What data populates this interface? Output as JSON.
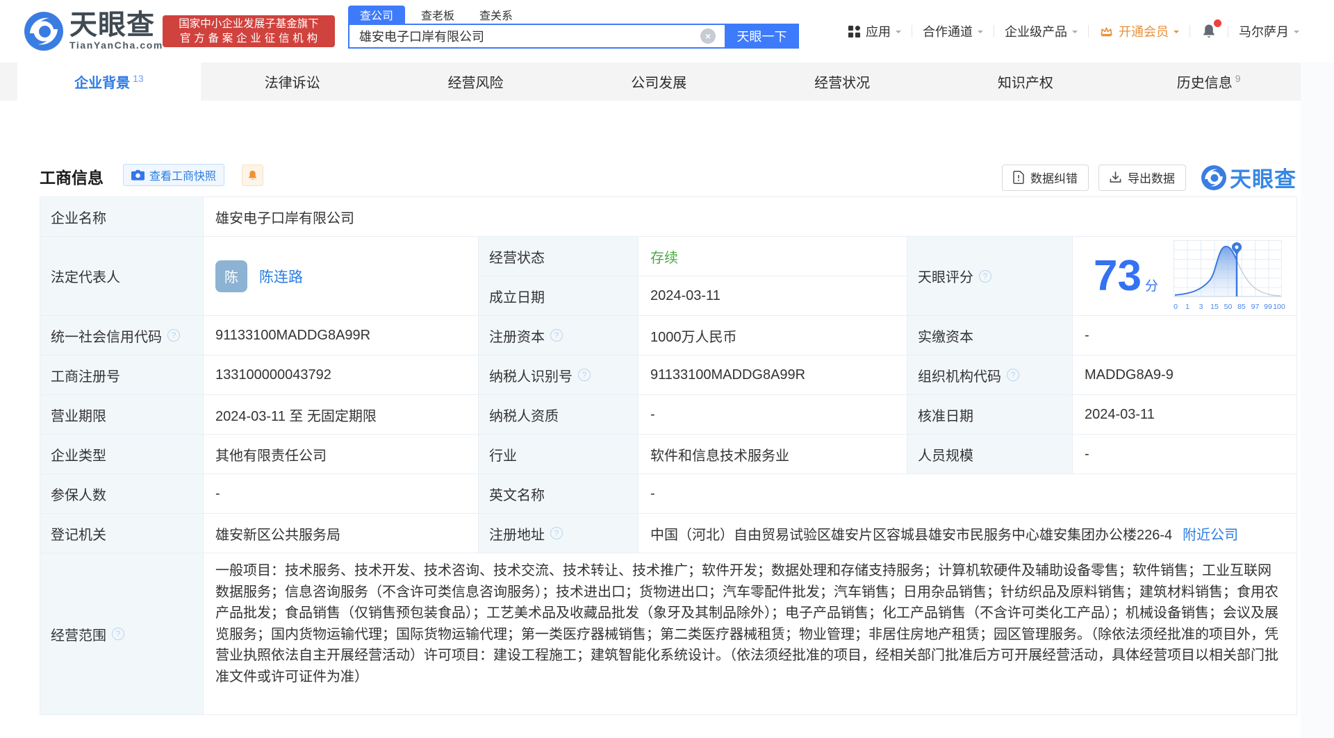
{
  "header": {
    "brand": "天眼查",
    "brand_domain": "TianYanCha.com",
    "badge_line1": "国家中小企业发展子基金旗下",
    "badge_line2": "官方备案企业征信机构",
    "search_tabs": [
      {
        "label": "查公司",
        "active": true
      },
      {
        "label": "查老板",
        "active": false
      },
      {
        "label": "查关系",
        "active": false
      }
    ],
    "search_value": "雄安电子口岸有限公司",
    "search_button": "天眼一下",
    "nav": [
      {
        "label": "应用"
      },
      {
        "label": "合作通道"
      },
      {
        "label": "企业级产品"
      },
      {
        "label": "开通会员"
      }
    ],
    "username": "马尔萨月"
  },
  "tabs": [
    {
      "label": "企业背景",
      "count": "13",
      "active": true
    },
    {
      "label": "法律诉讼",
      "count": "",
      "active": false
    },
    {
      "label": "经营风险",
      "count": "",
      "active": false
    },
    {
      "label": "公司发展",
      "count": "",
      "active": false
    },
    {
      "label": "经营状况",
      "count": "",
      "active": false
    },
    {
      "label": "知识产权",
      "count": "",
      "active": false
    },
    {
      "label": "历史信息",
      "count": "9",
      "active": false
    }
  ],
  "section": {
    "title": "工商信息",
    "snapshot_button": "查看工商快照",
    "correction_button": "数据纠错",
    "export_button": "导出数据",
    "watermark": "天眼查"
  },
  "company": {
    "name_label": "企业名称",
    "name": "雄安电子口岸有限公司",
    "legal_rep_label": "法定代表人",
    "legal_rep": "陈连路",
    "legal_rep_avatar": "陈",
    "status_label": "经营状态",
    "status": "存续",
    "established_label": "成立日期",
    "established": "2024-03-11",
    "score_label": "天眼评分",
    "score": "73",
    "score_unit": "分",
    "credit_code_label": "统一社会信用代码",
    "credit_code": "91133100MADDG8A99R",
    "reg_capital_label": "注册资本",
    "reg_capital": "1000万人民币",
    "paid_capital_label": "实缴资本",
    "paid_capital": "-",
    "reg_number_label": "工商注册号",
    "reg_number": "133100000043792",
    "taxpayer_id_label": "纳税人识别号",
    "taxpayer_id": "91133100MADDG8A99R",
    "org_code_label": "组织机构代码",
    "org_code": "MADDG8A9-9",
    "business_term_label": "营业期限",
    "business_term": "2024-03-11 至 无固定期限",
    "taxpayer_quality_label": "纳税人资质",
    "taxpayer_quality": "-",
    "approval_date_label": "核准日期",
    "approval_date": "2024-03-11",
    "company_type_label": "企业类型",
    "company_type": "其他有限责任公司",
    "industry_label": "行业",
    "industry": "软件和信息技术服务业",
    "staff_size_label": "人员规模",
    "staff_size": "-",
    "insured_label": "参保人数",
    "insured": "-",
    "english_name_label": "英文名称",
    "english_name": "-",
    "registry_label": "登记机关",
    "registry": "雄安新区公共服务局",
    "address_label": "注册地址",
    "address": "中国（河北）自由贸易试验区雄安片区容城县雄安市民服务中心雄安集团办公楼226-4",
    "nearby_link": "附近公司",
    "scope_label": "经营范围",
    "scope": "一般项目：技术服务、技术开发、技术咨询、技术交流、技术转让、技术推广；软件开发；数据处理和存储支持服务；计算机软硬件及辅助设备零售；软件销售；工业互联网数据服务；信息咨询服务（不含许可类信息咨询服务）；技术进出口；货物进出口；汽车零配件批发；汽车销售；日用杂品销售；针纺织品及原料销售；建筑材料销售；食用农产品批发；食品销售（仅销售预包装食品）；工艺美术品及收藏品批发（象牙及其制品除外）；电子产品销售；化工产品销售（不含许可类化工产品）；机械设备销售；会议及展览服务；国内货物运输代理；国际货物运输代理；第一类医疗器械销售；第二类医疗器械租赁；物业管理；非居住房地产租赁；园区管理服务。（除依法须经批准的项目外，凭营业执照依法自主开展经营活动）许可项目：建设工程施工；建筑智能化系统设计。（依法须经批准的项目，经相关部门批准后方可开展经营活动，具体经营项目以相关部门批准文件或许可证件为准）"
  },
  "chart_data": {
    "type": "area",
    "title": "天眼评分分布曲线",
    "score": 73,
    "x_ticks": [
      "0",
      "1",
      "3",
      "15",
      "50",
      "85",
      "97",
      "99",
      "100"
    ],
    "marker_position": 73
  }
}
